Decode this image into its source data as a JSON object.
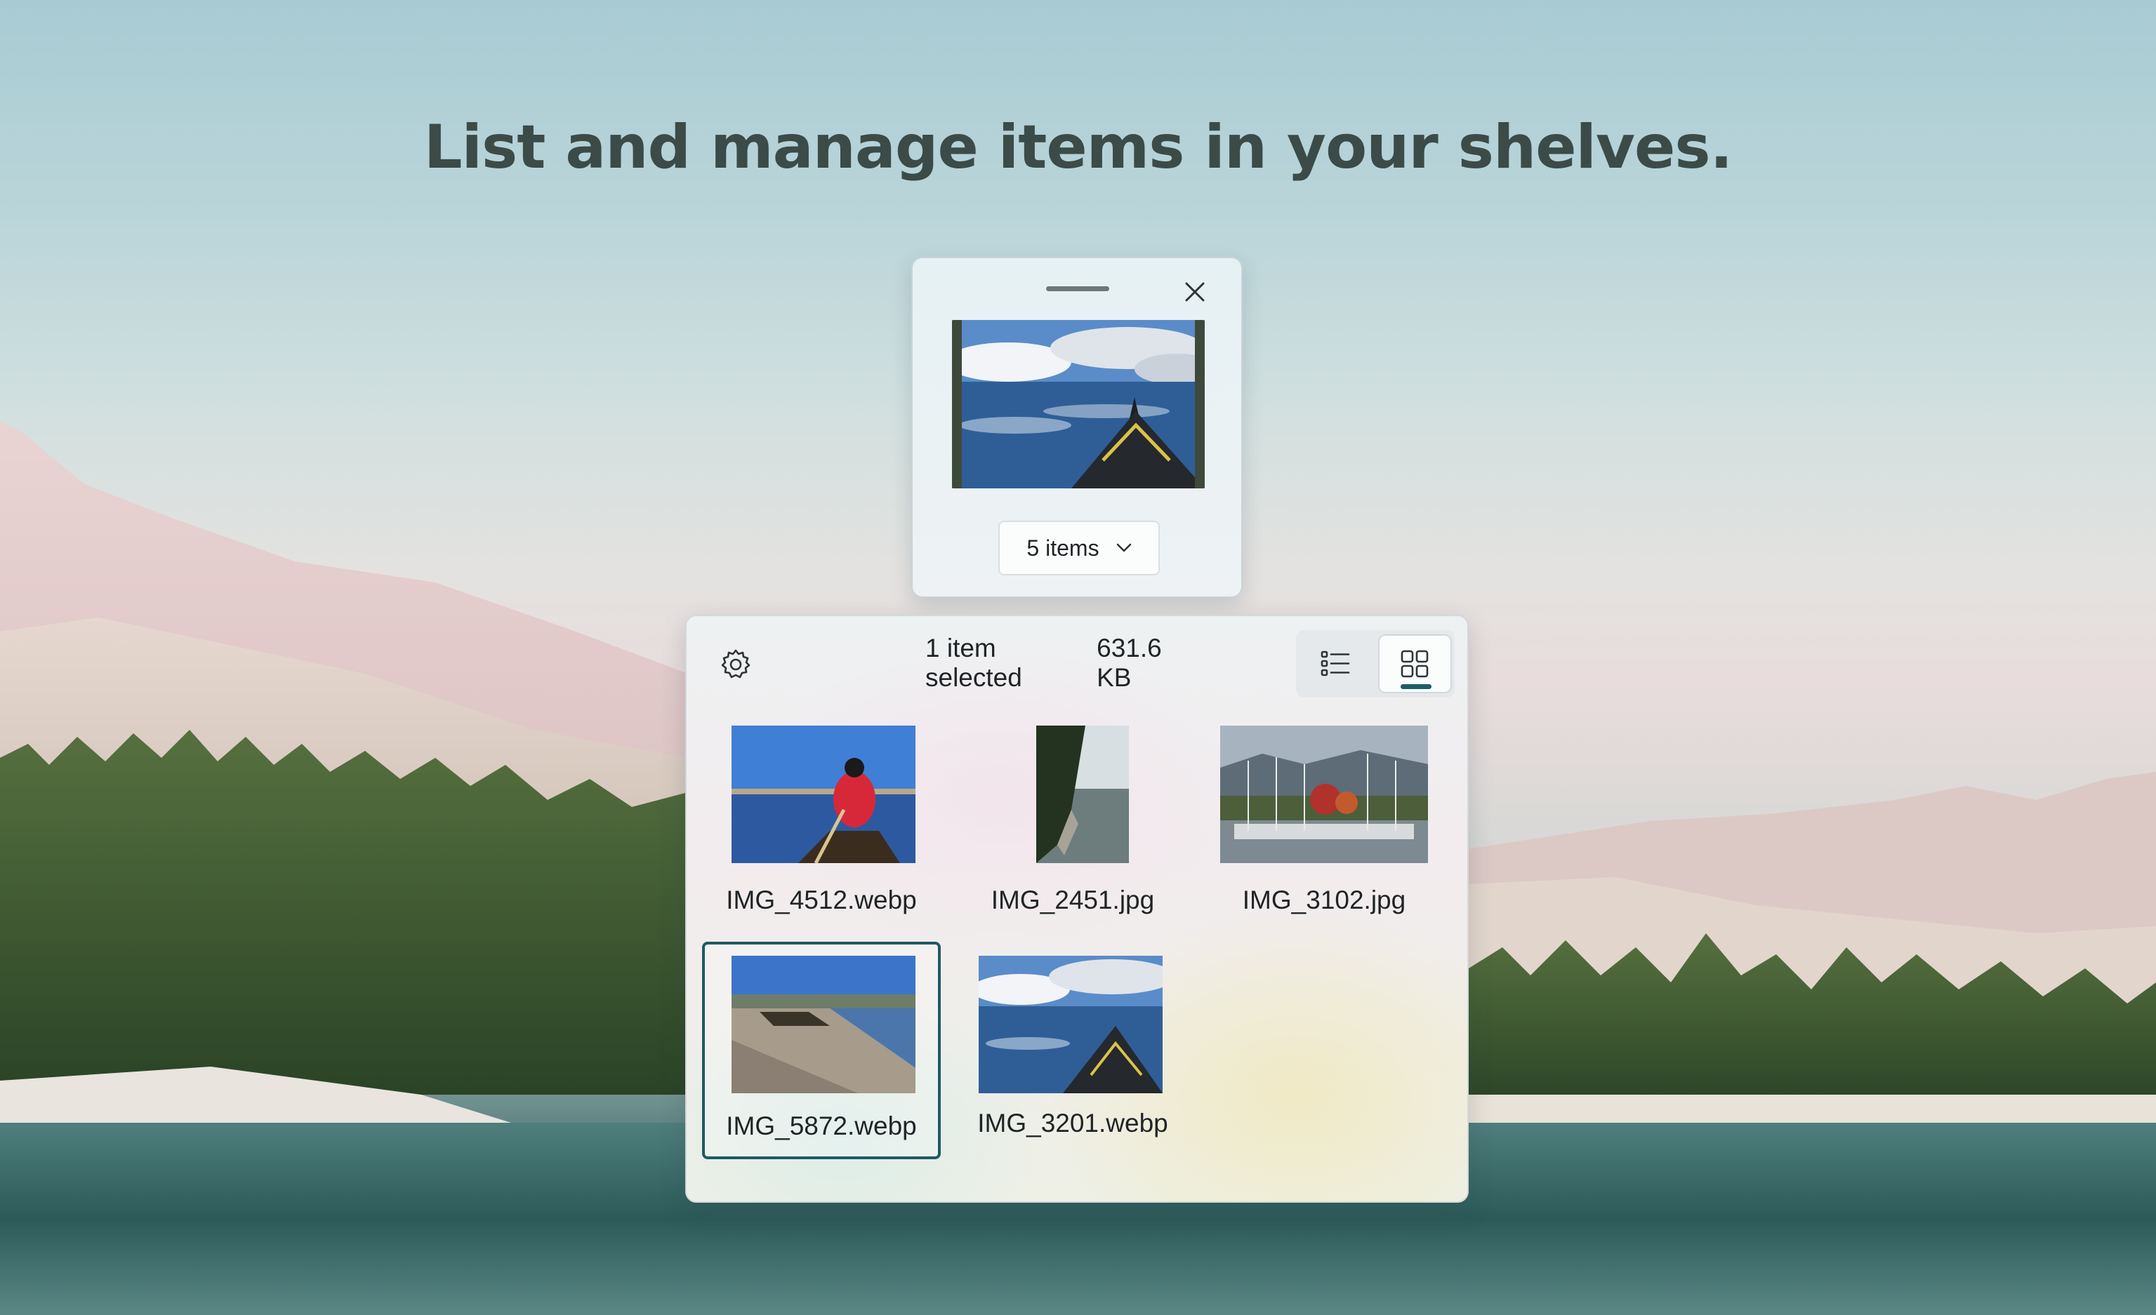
{
  "headline": "List and manage items in your shelves.",
  "shelf": {
    "close_icon": "close-icon",
    "preview_file": "IMG_3201.webp",
    "item_count_label": "5 items",
    "dropdown_icon": "chevron-down-icon"
  },
  "flyout": {
    "settings_icon": "gear-icon",
    "selection_label": "1 item selected",
    "selection_size": "631.6 KB",
    "view_modes": [
      {
        "name": "list-view",
        "icon": "list-icon",
        "active": false
      },
      {
        "name": "grid-view",
        "icon": "grid-icon",
        "active": true
      }
    ],
    "items": [
      {
        "filename": "IMG_4512.webp",
        "selected": false
      },
      {
        "filename": "IMG_2451.jpg",
        "selected": false
      },
      {
        "filename": "IMG_3102.jpg",
        "selected": false
      },
      {
        "filename": "IMG_5872.webp",
        "selected": true
      },
      {
        "filename": "IMG_3201.webp",
        "selected": false
      }
    ]
  },
  "colors": {
    "accent": "#1d5e66",
    "text": "#1f2426",
    "headline": "#3b4b48"
  }
}
